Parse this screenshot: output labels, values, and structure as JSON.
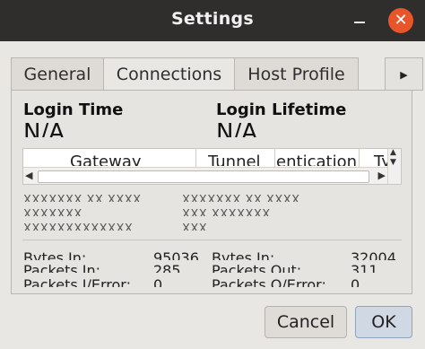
{
  "window": {
    "title": "Settings",
    "close_glyph": "✕"
  },
  "tabs": [
    {
      "label": "General"
    },
    {
      "label": "Connections"
    },
    {
      "label": "Host Profile"
    }
  ],
  "tab_scroll_glyph": "▶",
  "login": {
    "time_label": "Login Time",
    "time_value": "N/A",
    "lifetime_label": "Login Lifetime",
    "lifetime_value": "N/A"
  },
  "table": {
    "columns": [
      "Gateway",
      "Tunnel",
      "Authentication",
      "Type"
    ]
  },
  "blurred_rows": [
    "XXXXXXX XX XXXX",
    "XXXXXXX XX XXXX",
    "XXXXXXX",
    "XXX XXXXXXX",
    "XXXXXXXXXXXXX",
    "XXX"
  ],
  "stats": {
    "left": [
      {
        "label": "Bytes In:",
        "value": "95036"
      },
      {
        "label": "Packets In:",
        "value": "285"
      },
      {
        "label": "Packets I/Error:",
        "value": "0"
      }
    ],
    "right": [
      {
        "label": "Bytes In:",
        "value": "32004"
      },
      {
        "label": "Packets Out:",
        "value": "311"
      },
      {
        "label": "Packets O/Error:",
        "value": "0"
      }
    ]
  },
  "buttons": {
    "cancel": "Cancel",
    "ok": "OK"
  }
}
